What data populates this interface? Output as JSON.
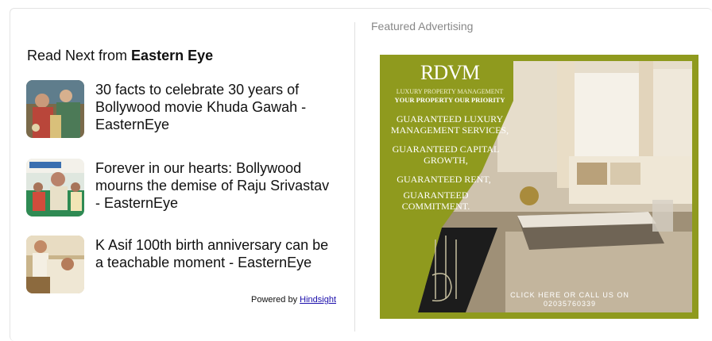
{
  "read_next": {
    "heading_prefix": "Read Next from ",
    "heading_brand": "Eastern Eye",
    "articles": [
      {
        "title": "30 facts to celebrate 30 years of Bollywood movie Khuda Gawah - EasternEye"
      },
      {
        "title": "Forever in our hearts: Bollywood mourns the demise of Raju Srivastav - EasternEye"
      },
      {
        "title": "K Asif 100th birth anniversary can be a teachable moment - EasternEye"
      }
    ],
    "powered_by_prefix": "Powered by ",
    "powered_by_link": "Hindsight"
  },
  "featured": {
    "label": "Featured Advertising",
    "ad": {
      "logo": "RDVM",
      "tagline1": "LUXURY PROPERTY MANAGEMENT",
      "tagline2": "YOUR PROPERTY OUR PRIORITY",
      "lines": [
        "GUARANTEED LUXURY",
        "MANAGEMENT SERVICES,",
        "GUARANTEED CAPITAL",
        "GROWTH,",
        "GUARANTEED RENT,",
        "GUARANTEED",
        "COMMITMENT."
      ],
      "cta_line1": "CLICK HERE OR CALL US ON",
      "cta_line2": "02035760339",
      "brand_color": "#8f9a1e"
    }
  }
}
